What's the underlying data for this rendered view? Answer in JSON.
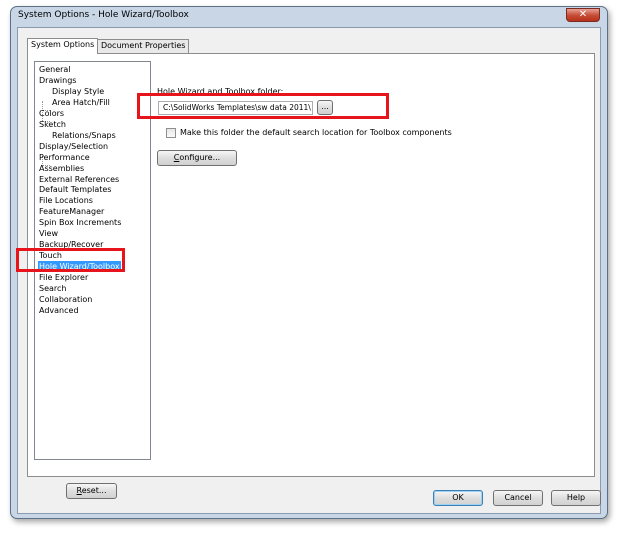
{
  "window": {
    "title": "System Options - Hole Wizard/Toolbox",
    "close_glyph": "✕"
  },
  "tabs": [
    {
      "label": "System Options",
      "active": true
    },
    {
      "label": "Document Properties",
      "active": false
    }
  ],
  "tree": {
    "items": [
      {
        "label": "General",
        "child": false
      },
      {
        "label": "Drawings",
        "child": false
      },
      {
        "label": "Display Style",
        "child": true
      },
      {
        "label": "Area Hatch/Fill",
        "child": true
      },
      {
        "label": "Colors",
        "child": false
      },
      {
        "label": "Sketch",
        "child": false
      },
      {
        "label": "Relations/Snaps",
        "child": true
      },
      {
        "label": "Display/Selection",
        "child": false
      },
      {
        "label": "Performance",
        "child": false
      },
      {
        "label": "Assemblies",
        "child": false
      },
      {
        "label": "External References",
        "child": false
      },
      {
        "label": "Default Templates",
        "child": false
      },
      {
        "label": "File Locations",
        "child": false
      },
      {
        "label": "FeatureManager",
        "child": false
      },
      {
        "label": "Spin Box Increments",
        "child": false
      },
      {
        "label": "View",
        "child": false
      },
      {
        "label": "Backup/Recover",
        "child": false
      },
      {
        "label": "Touch",
        "child": false
      },
      {
        "label": "Hole Wizard/Toolbox",
        "child": false,
        "selected": true
      },
      {
        "label": "File Explorer",
        "child": false
      },
      {
        "label": "Search",
        "child": false
      },
      {
        "label": "Collaboration",
        "child": false
      },
      {
        "label": "Advanced",
        "child": false
      }
    ]
  },
  "panel": {
    "folder_label_accel": "H",
    "folder_label_rest": "ole Wizard and Toolbox folder:",
    "folder_value": "C:\\SolidWorks Templates\\sw data 2011\\",
    "browse_label": "...",
    "checkbox_label": "Make this folder the default search location for Toolbox components",
    "checkbox_checked": false,
    "configure_accel": "C",
    "configure_rest": "onfigure..."
  },
  "footer": {
    "reset_accel": "R",
    "reset_rest": "eset...",
    "ok_label": "OK",
    "cancel_label": "Cancel",
    "help_label": "Help"
  },
  "highlight_color": "#e8141c"
}
